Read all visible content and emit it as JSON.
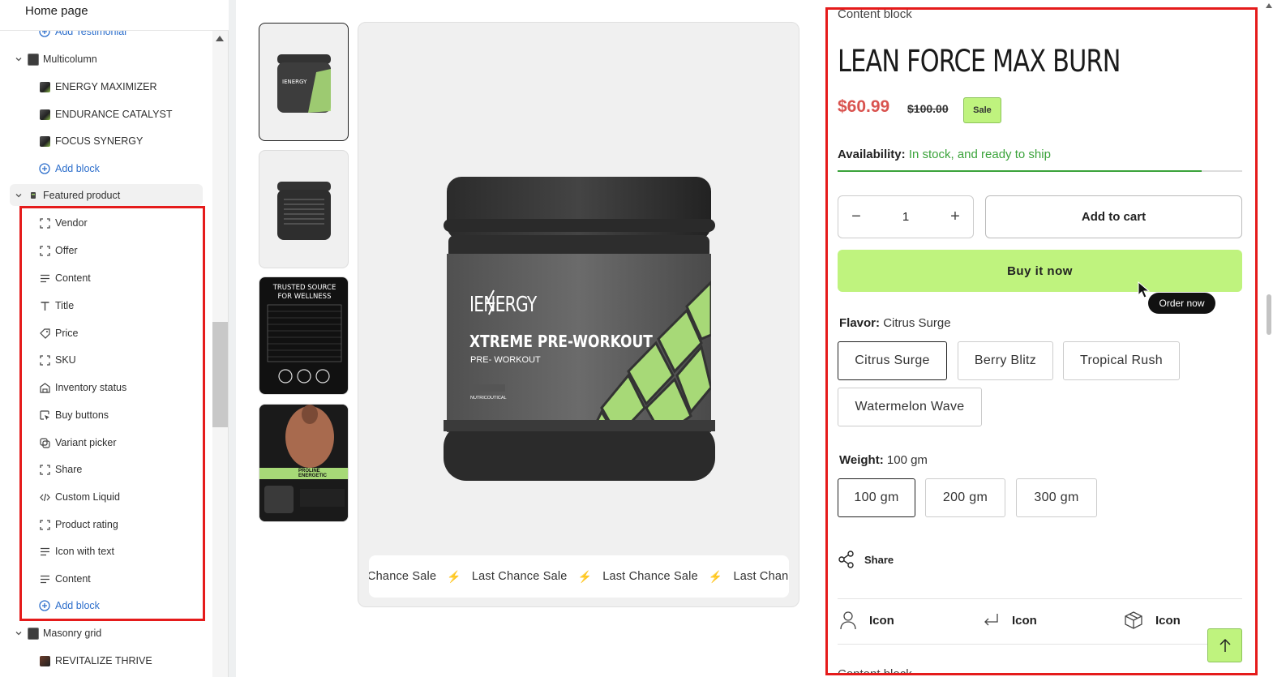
{
  "sidebar": {
    "header": "Home page",
    "top_partial": "Add Testimonial",
    "multicolumn": {
      "label": "Multicolumn",
      "items": [
        "ENERGY MAXIMIZER",
        "ENDURANCE CATALYST",
        "FOCUS SYNERGY"
      ],
      "add_block": "Add block"
    },
    "featured": {
      "label": "Featured product",
      "items": [
        {
          "label": "Vendor",
          "icon": "bracket-icon"
        },
        {
          "label": "Offer",
          "icon": "bracket-icon"
        },
        {
          "label": "Content",
          "icon": "text-lines-icon"
        },
        {
          "label": "Title",
          "icon": "title-t-icon"
        },
        {
          "label": "Price",
          "icon": "price-tag-icon"
        },
        {
          "label": "SKU",
          "icon": "bracket-icon"
        },
        {
          "label": "Inventory status",
          "icon": "inventory-icon"
        },
        {
          "label": "Buy buttons",
          "icon": "cursor-click-icon"
        },
        {
          "label": "Variant picker",
          "icon": "variant-icon"
        },
        {
          "label": "Share",
          "icon": "bracket-icon"
        },
        {
          "label": "Custom Liquid",
          "icon": "code-icon"
        },
        {
          "label": "Product rating",
          "icon": "rating-icon"
        },
        {
          "label": "Icon with text",
          "icon": "text-lines-icon"
        },
        {
          "label": "Content",
          "icon": "text-lines-icon"
        }
      ],
      "add_block": "Add block"
    },
    "masonry": {
      "label": "Masonry grid",
      "items": [
        "REVITALIZE THRIVE"
      ]
    }
  },
  "gallery": {
    "thumb3_text": [
      "TRUSTED SOURCE",
      "FOR WELLNESS"
    ],
    "thumb4_text": "PROLINE ENERGETIC",
    "jar": {
      "brand": "IENERGY",
      "product": "XTREME PRE-WORKOUT",
      "sub": "PRE- WORKOUT",
      "tag": "NUTRICOUTICAL"
    },
    "marquee": [
      "Chance Sale",
      "Last Chance Sale",
      "Last Chance Sale",
      "Last Chance Sale"
    ]
  },
  "product": {
    "content_label": "Content block",
    "title": "LEAN FORCE MAX BURN",
    "price_sale": "$60.99",
    "price_original": "$100.00",
    "sale_badge": "Sale",
    "availability_label": "Availability:",
    "availability_value": "In stock, and ready to ship",
    "stock_fraction": 0.9,
    "quantity": "1",
    "add_to_cart": "Add to cart",
    "buy_now": "Buy it now",
    "tooltip": "Order now",
    "flavor_label": "Flavor:",
    "flavor_value": "Citrus Surge",
    "flavors": [
      "Citrus Surge",
      "Berry Blitz",
      "Tropical Rush",
      "Watermelon Wave"
    ],
    "weight_label": "Weight:",
    "weight_value": "100 gm",
    "weights": [
      "100 gm",
      "200 gm",
      "300 gm"
    ],
    "share": "Share",
    "icons": [
      {
        "label": "Icon",
        "icon": "user-icon"
      },
      {
        "label": "Icon",
        "icon": "return-arrow-icon"
      },
      {
        "label": "Icon",
        "icon": "box-icon"
      }
    ],
    "cut_label": "Content block"
  },
  "colors": {
    "accent_green": "#bff37e",
    "sale_red": "#d9534f",
    "stock_green": "#3aa33a",
    "highlight_red": "#e51b1b",
    "link_blue": "#2c6ecb"
  }
}
